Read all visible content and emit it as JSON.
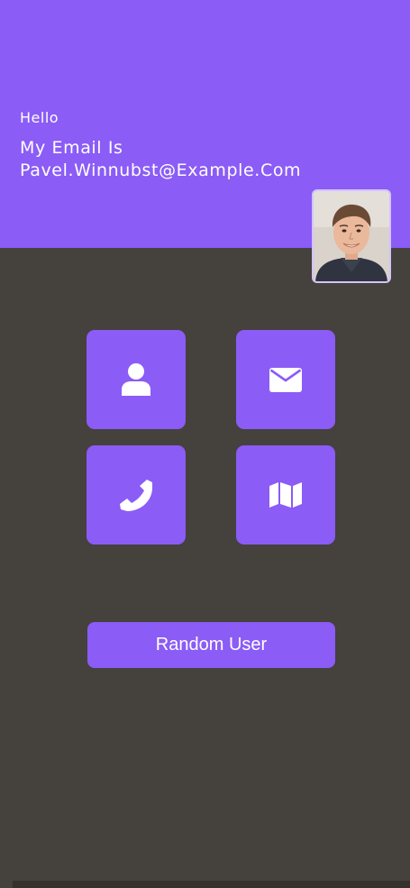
{
  "header": {
    "greeting": "Hello",
    "info_label": "My Email Is",
    "info_value": "Pavel.Winnubst@Example.Com"
  },
  "tiles": [
    {
      "name": "user-icon"
    },
    {
      "name": "envelope-icon"
    },
    {
      "name": "phone-icon"
    },
    {
      "name": "map-icon"
    }
  ],
  "actions": {
    "random_user_label": "Random User"
  },
  "colors": {
    "accent": "#8b5cf6",
    "background": "#45413c",
    "avatar_border": "#d4c3fb"
  }
}
